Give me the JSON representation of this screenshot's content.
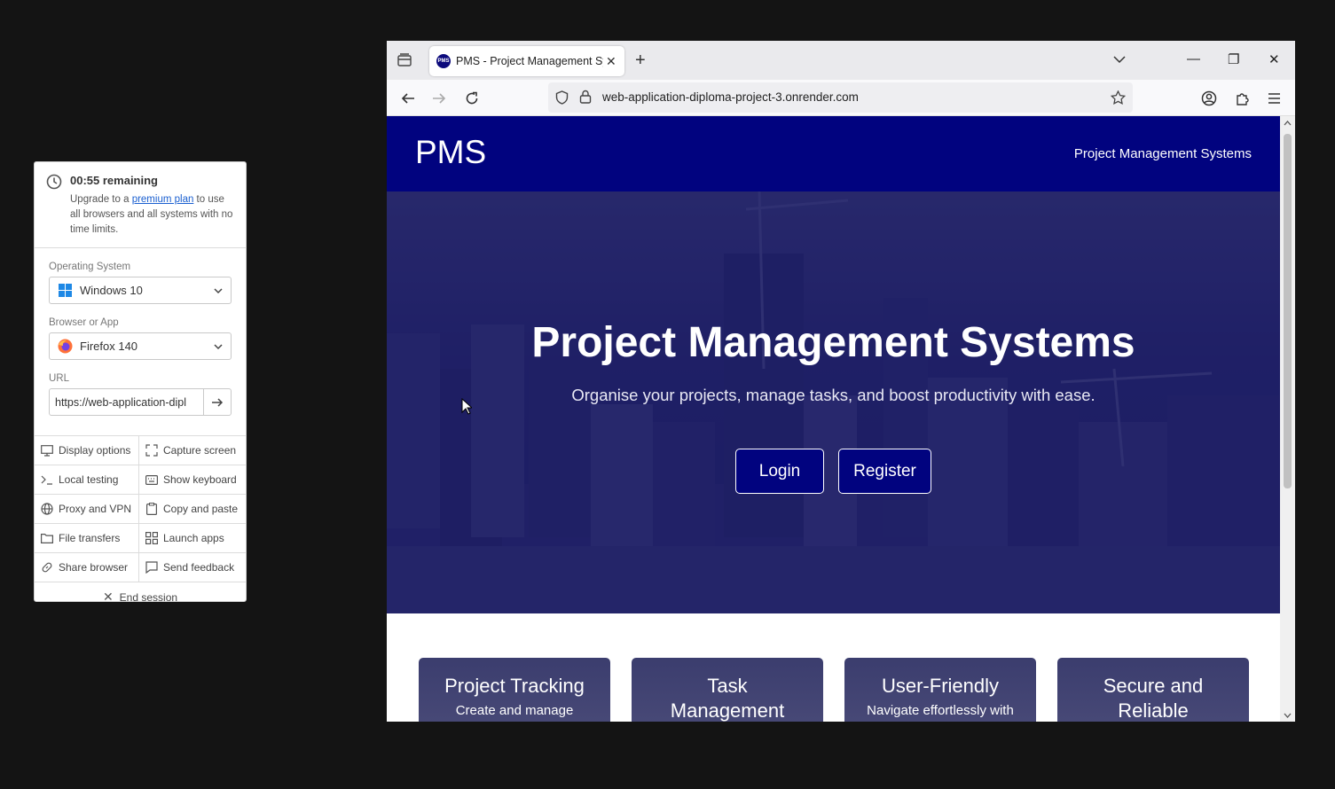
{
  "panel": {
    "timer_title": "00:55 remaining",
    "timer_text_pre": "Upgrade to a ",
    "timer_link": "premium plan",
    "timer_text_post": " to use all browsers and all systems with no time limits.",
    "os_label": "Operating System",
    "os_value": "Windows 10",
    "browser_label": "Browser or App",
    "browser_value": "Firefox 140",
    "url_label": "URL",
    "url_value": "https://web-application-dipl",
    "actions": [
      "Display options",
      "Capture screen",
      "Local testing",
      "Show keyboard",
      "Proxy and VPN",
      "Copy and paste",
      "File transfers",
      "Launch apps",
      "Share browser",
      "Send feedback"
    ],
    "end_session": "End session"
  },
  "browser": {
    "tab_title": "PMS - Project Management Systems",
    "favicon_text": "PMS",
    "address": "web-application-diploma-project-3.onrender.com"
  },
  "page": {
    "brand": "PMS",
    "nav_link": "Project Management Systems",
    "hero_title": "Project Management Systems",
    "hero_subtitle": "Organise your projects, manage tasks, and boost productivity with ease.",
    "login": "Login",
    "register": "Register",
    "features": [
      {
        "title": "Project Tracking",
        "desc": "Create and manage"
      },
      {
        "title": "Task Management",
        "desc": ""
      },
      {
        "title": "User-Friendly",
        "desc": "Navigate effortlessly with"
      },
      {
        "title": "Secure and Reliable",
        "desc": ""
      }
    ]
  },
  "colors": {
    "navy": "#01037f",
    "link": "#1a5fd0"
  }
}
